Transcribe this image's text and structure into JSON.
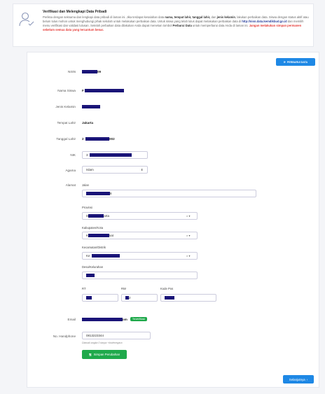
{
  "notice": {
    "title": "Verifikasi dan Melengkapi Data Pribadi",
    "p1": "Periksa dengan seksama dan lengkapi data pribadi di laman ini. Jika terdapat kesalahan data ",
    "b1": "nama, tempat lahir, tanggal lahir,",
    "p2": " dan ",
    "b2": "jenis kelamin",
    "p3": ", lakukan perbaikan data. Siswa dengan status aktif atau belum lulus mohon untuk menghubungi pihak sekolah untuk melakukan perbaikan data. Untuk siswa yang telah lulus dapat melakukan perbaikan data di ",
    "link": "http://nisn.data.kemdikbud.go.id",
    "p4": " dan memilih menu verifikasi dan validasi lulusan. Setelah perbaikan data dilakukan Anda dapat menekan tombol ",
    "b3": "Perbarui Data",
    "p5": " untuk memperbarui data Anda di laman ini. ",
    "warn": "Jangan melakukan simpan permanen sebelum semua data yang tercantum benar."
  },
  "actions": {
    "update": "PERBARUI DATA",
    "save": "Simpan Perubahan",
    "next": "Selanjutnya"
  },
  "labels": {
    "nisn": "NISN",
    "nama": "Nama Siswa",
    "jk": "Jenis Kelamin",
    "tempat": "Tempat Lahir",
    "tanggal": "Tanggal Lahir",
    "nik": "NIK",
    "agama": "Agama",
    "alamat": "Alamat",
    "email": "Email",
    "hp": "No. Handphone"
  },
  "values": {
    "nisn_end": "09",
    "nama_start": "F",
    "tempat": "Jakarta",
    "tanggal_start": "2",
    "tanggal_end": "002",
    "nik_start": "3",
    "agama": "Islam",
    "jalan_end": "8",
    "provinsi_start": "D",
    "provinsi_end": "arta",
    "kab_start": "K",
    "kab_end": "sat",
    "kec_start": "Ke",
    "email_end": "om",
    "email_status": "Terverifikasi",
    "hp": "0813223344",
    "hp_hint": "Diawali angka 0 tanpa +kodenegara"
  },
  "alamat": {
    "jalan": "Jalan",
    "provinsi": "Provinsi",
    "kab": "Kabupaten/Kota",
    "kec": "Kecamatan/Distrik",
    "desa": "Desa/Kelurahan",
    "rt": "RT",
    "rw": "RW",
    "pos": "Kode Pos",
    "rw_end": "2"
  },
  "colors": {
    "primary": "#1e88e5",
    "success": "#1fa94b",
    "redaction": "#1a1478",
    "warning": "#e53935"
  }
}
